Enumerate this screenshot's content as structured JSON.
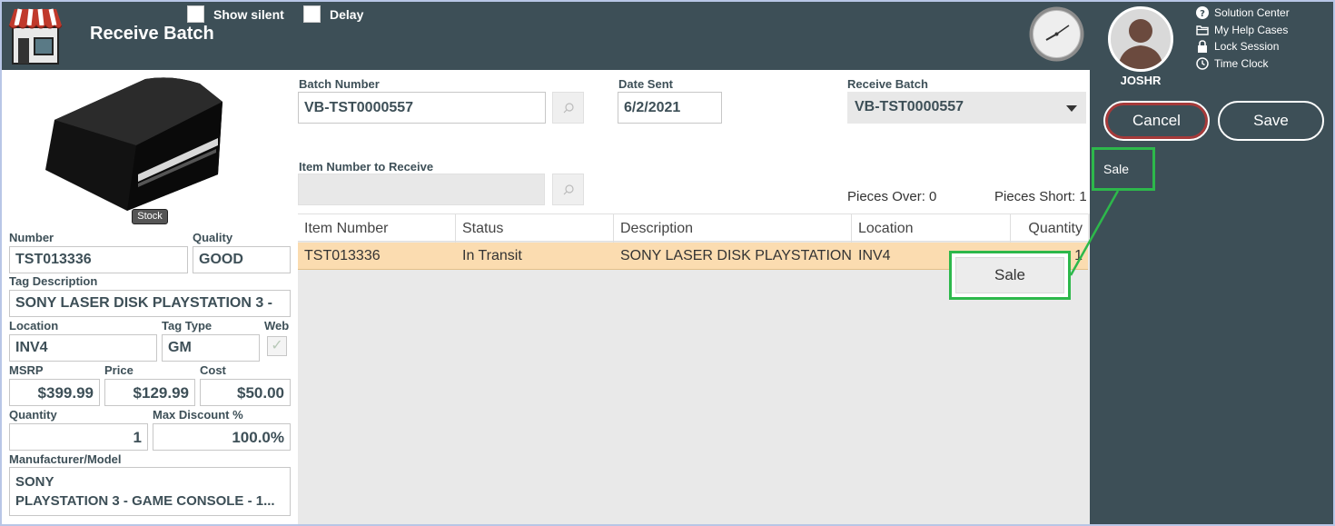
{
  "header": {
    "title": "Receive Batch",
    "show_silent_label": "Show silent",
    "delay_label": "Delay"
  },
  "user": {
    "name": "JOSHR"
  },
  "help_links": [
    {
      "label": "Solution Center",
      "icon": "question-circle-icon"
    },
    {
      "label": "My Help Cases",
      "icon": "folder-icon"
    },
    {
      "label": "Lock Session",
      "icon": "lock-icon"
    },
    {
      "label": "Time Clock",
      "icon": "clock-icon"
    }
  ],
  "actions": {
    "cancel": "Cancel",
    "save": "Save",
    "side_menu_sale": "Sale"
  },
  "product": {
    "badge": "Stock",
    "number_label": "Number",
    "number": "TST013336",
    "quality_label": "Quality",
    "quality": "GOOD",
    "tag_desc_label": "Tag Description",
    "tag_desc": "SONY LASER DISK PLAYSTATION 3 -",
    "location_label": "Location",
    "location": "INV4",
    "tag_type_label": "Tag Type",
    "tag_type": "GM",
    "web_label": "Web",
    "msrp_label": "MSRP",
    "msrp": "$399.99",
    "price_label": "Price",
    "price": "$129.99",
    "cost_label": "Cost",
    "cost": "$50.00",
    "quantity_label": "Quantity",
    "quantity": "1",
    "max_discount_label": "Max Discount %",
    "max_discount": "100.0%",
    "mfr_label": "Manufacturer/Model",
    "mfr_line1": "SONY",
    "mfr_line2": "PLAYSTATION 3 - GAME CONSOLE - 1..."
  },
  "batch": {
    "batch_number_label": "Batch Number",
    "batch_number": "VB-TST0000557",
    "date_sent_label": "Date Sent",
    "date_sent": "6/2/2021",
    "receive_batch_label": "Receive Batch",
    "receive_batch": "VB-TST0000557",
    "item_number_label": "Item Number to Receive",
    "item_number": "",
    "pieces_over": "Pieces Over: 0",
    "pieces_short": "Pieces Short: 1"
  },
  "grid": {
    "columns": [
      "Item Number",
      "Status",
      "Description",
      "Location",
      "Quantity"
    ],
    "row": {
      "item_number": "TST013336",
      "status": "In Transit",
      "description": "SONY LASER DISK PLAYSTATION 3 -",
      "location": "INV4",
      "quantity": "1"
    }
  },
  "context_menu": {
    "sale": "Sale"
  },
  "colors": {
    "header_bg": "#3d4f57",
    "highlight_row": "#fbdcb0",
    "annotation_green": "#2db84b",
    "cancel_ring": "#a63a3a"
  }
}
